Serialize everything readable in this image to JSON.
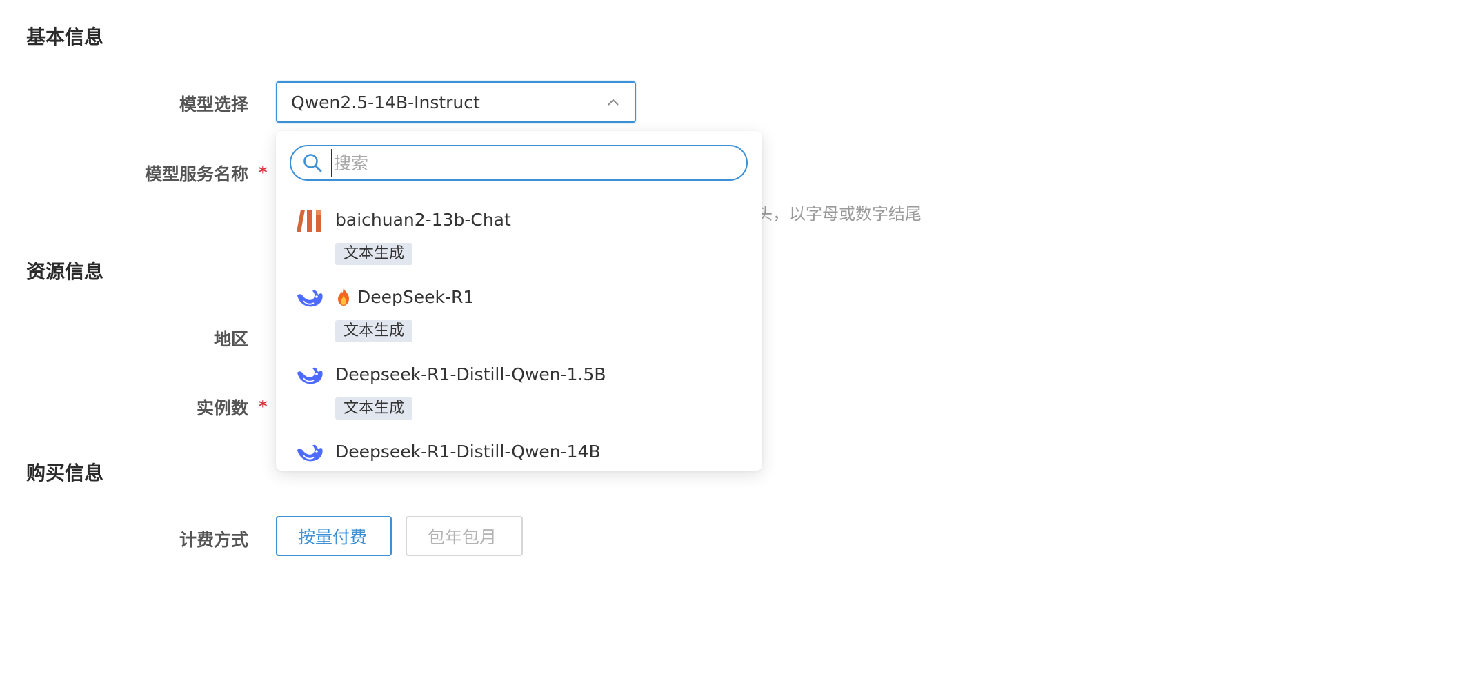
{
  "sections": {
    "basic": "基本信息",
    "resource": "资源信息",
    "purchase": "购买信息"
  },
  "form": {
    "model_select_label": "模型选择",
    "model_selected": "Qwen2.5-14B-Instruct",
    "service_name_label": "模型服务名称",
    "service_name_hint_visible": "头，以字母或数字结尾",
    "region_label": "地区",
    "instances_label": "实例数",
    "billing_label": "计费方式",
    "billing_options": [
      "按量付费",
      "包年包月"
    ],
    "billing_selected": "按量付费"
  },
  "dropdown": {
    "search_placeholder": "搜索",
    "options": [
      {
        "name": "baichuan2-13b-Chat",
        "tag": "文本生成",
        "logo": "baichuan-logo-icon",
        "hot": false
      },
      {
        "name": "DeepSeek-R1",
        "tag": "文本生成",
        "logo": "deepseek-whale-icon",
        "hot": true
      },
      {
        "name": "Deepseek-R1-Distill-Qwen-1.5B",
        "tag": "文本生成",
        "logo": "deepseek-whale-icon",
        "hot": false
      },
      {
        "name": "Deepseek-R1-Distill-Qwen-14B",
        "tag": "",
        "logo": "deepseek-whale-icon",
        "hot": false
      }
    ]
  },
  "colors": {
    "accent": "#3d8fd6",
    "required": "#d9363e",
    "tag_bg": "#e1e6ef",
    "baichuan_logo": "#d9643a",
    "deepseek_logo": "#4d6bfe"
  }
}
